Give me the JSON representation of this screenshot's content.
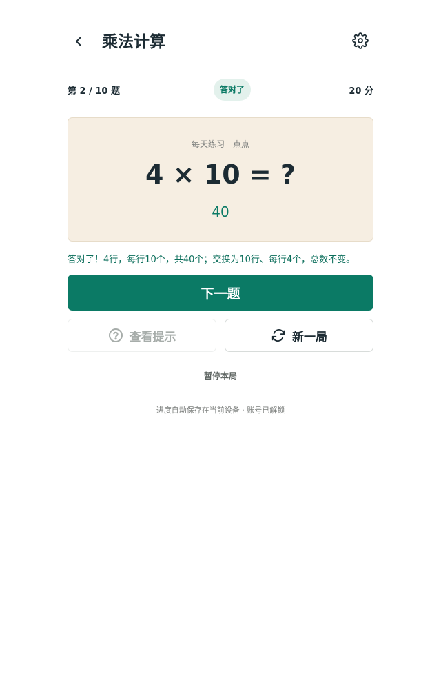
{
  "header": {
    "title": "乘法计算",
    "back_icon": "chevron-left-icon",
    "settings_icon": "gear-icon"
  },
  "status": {
    "progress": "第 2 / 10 题",
    "badge": "答对了",
    "score": "20 分"
  },
  "card": {
    "subtitle": "每天练习一点点",
    "question": "4 × 10 = ?",
    "answer": "40"
  },
  "feedback": "答对了！4行，每行10个，共40个；交换为10行、每行4个，总数不变。",
  "actions": {
    "next_label": "下一题",
    "hint_label": "查看提示",
    "hint_icon": "question-circle-icon",
    "new_label": "新一局",
    "new_icon": "refresh-icon",
    "pause_label": "暂停本局"
  },
  "footer": {
    "note": "进度自动保存在当前设备 · 账号已解锁"
  },
  "colors": {
    "accent": "#0b7a65",
    "card_bg": "#f6eee2",
    "badge_bg": "#e3f1ec",
    "text": "#1c2b33"
  }
}
